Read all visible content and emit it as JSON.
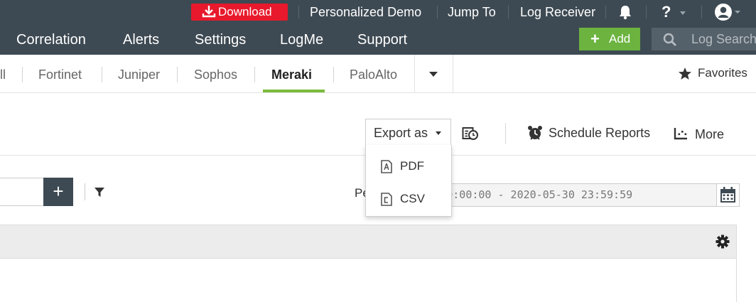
{
  "topbar": {
    "download_label": "Download",
    "links": [
      "Personalized Demo",
      "Jump To",
      "Log Receiver"
    ],
    "help_label": "?",
    "colors": {
      "bar": "#3e4a53",
      "download": "#e8192c"
    }
  },
  "nav": {
    "items": [
      "Correlation",
      "Alerts",
      "Settings",
      "LogMe",
      "Support"
    ],
    "add_label": "Add",
    "search_placeholder": "Log Search",
    "colors": {
      "add": "#6cb33f"
    }
  },
  "tabs": {
    "items": [
      "ll",
      "Fortinet",
      "Juniper",
      "Sophos",
      "Meraki",
      "PaloAlto"
    ],
    "active": "Meraki",
    "favorites_label": "Favorites",
    "colors": {
      "underline": "#7bbb3c"
    }
  },
  "toolbar": {
    "export_label": "Export as",
    "schedule_label": "Schedule Reports",
    "more_label": "More"
  },
  "export_menu": {
    "items": [
      "PDF",
      "CSV"
    ]
  },
  "filter": {
    "period_label": "Pe",
    "period_value": "-01-01 00:00:00 - 2020-05-30 23:59:59"
  }
}
